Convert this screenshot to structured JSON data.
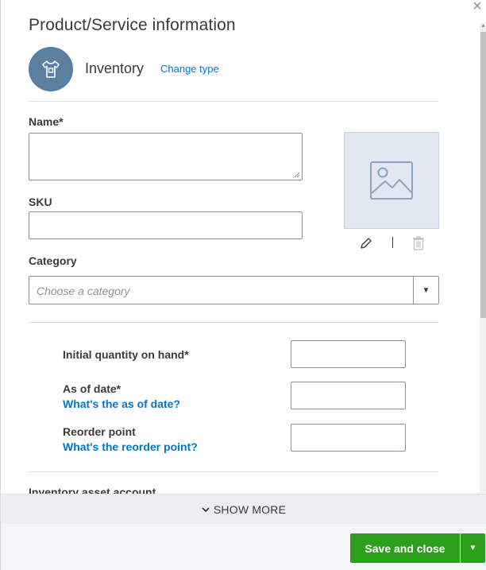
{
  "panel": {
    "title": "Product/Service information",
    "close_symbol": "×"
  },
  "type": {
    "label": "Inventory",
    "change_link": "Change type",
    "icon": "tshirt-icon"
  },
  "form": {
    "name_label": "Name*",
    "name_value": "",
    "sku_label": "SKU",
    "sku_value": "",
    "category_label": "Category",
    "category_placeholder": "Choose a category",
    "image_icon": "image-placeholder-icon",
    "edit_icon": "pencil-icon",
    "delete_icon": "trash-icon"
  },
  "inventory": {
    "qty_label": "Initial quantity on hand*",
    "qty_value": "",
    "date_label": "As of date*",
    "date_help": "What's the as of date?",
    "date_value": "",
    "reorder_label": "Reorder point",
    "reorder_help": "What's the reorder point?",
    "reorder_value": "",
    "asset_account_label": "Inventory asset account"
  },
  "show_more": {
    "label": "SHOW MORE",
    "icon": "chevron-down-icon"
  },
  "footer": {
    "save_label": "Save and close",
    "dropdown_icon": "caret-down-icon"
  },
  "colors": {
    "accent_green": "#2ca01c",
    "link_blue": "#0077c5",
    "type_circle": "#5a7fa0"
  }
}
